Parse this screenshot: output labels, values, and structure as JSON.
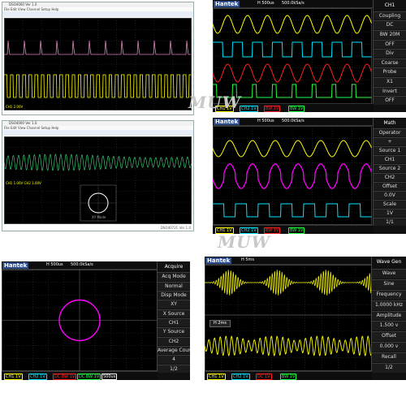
{
  "watermark": "MUW",
  "panels": {
    "p1": {
      "window_title": "DSO4000 Ver 1.0",
      "menu": "File  Edit  View  Channel  Setup  Help",
      "status_left": "CH1 2.00V",
      "status_right": "DSO4072C Ver 1.0"
    },
    "p2": {
      "brand": "Hantek",
      "timebase": "H 500us",
      "sample": "500.0kSa/s",
      "menu_items": [
        "CH1",
        "Coupling",
        "DC",
        "BW 20M",
        "OFF",
        "Div",
        "Coarse",
        "Probe",
        "X1",
        "Invert",
        "OFF"
      ],
      "bottom": [
        "CH1 1V",
        "CH2 1V",
        "BW 1V",
        "BW 1V"
      ]
    },
    "p3": {
      "window_title": "DSO4000 Ver 1.0",
      "menu": "File  Edit  View  Channel  Setup  Help",
      "status_left": "CH1 1.00V  CH2 1.00V",
      "xy_label": "XY Mode",
      "status_right": "DSO4072C Ver 1.0"
    },
    "p4": {
      "brand": "Hantek",
      "timebase": "H 500us",
      "sample": "500.0kSa/s",
      "menu_items": [
        "Math",
        "Operator",
        "+",
        "Source 1",
        "CH1",
        "Source 2",
        "CH2",
        "Offset",
        "0.0V",
        "Scale",
        "1V",
        "1/1"
      ],
      "bottom": [
        "CH1 1V",
        "CH2 1V",
        "BW 1V",
        "BW 1V"
      ]
    },
    "p5": {
      "brand": "Hantek",
      "timebase": "H 500us",
      "sample": "500.0kSa/s",
      "menu_items": [
        "Acquire",
        "Acq Mode",
        "Normal",
        "Disp Mode",
        "XY",
        "X Source",
        "CH1",
        "Y Source",
        "CH2",
        "Average Count",
        "4",
        "1/2"
      ],
      "bottom": [
        "CH1 1V",
        "CH2 1V",
        "DC BW 1V",
        "DC BW 1V",
        "500us"
      ]
    },
    "p6": {
      "brand": "Hantek",
      "timebase": "H 5ms",
      "zoom": "H 2ms",
      "menu_items": [
        "Wave Gen",
        "Wave",
        "Sine",
        "Frequency",
        "1.0000 kHz",
        "Amplitude",
        "1.500 v",
        "Offset",
        "0.000 v",
        "Recall",
        "1/2"
      ],
      "bottom": [
        "CH1 1V",
        "CH2 1V",
        "DC 1V",
        "BW 1V"
      ]
    }
  },
  "colors": {
    "ch1": "#ffff00",
    "ch2": "#00e5ff",
    "ch3": "#ff2020",
    "ch4": "#20ff40",
    "math": "#ff00ff"
  }
}
